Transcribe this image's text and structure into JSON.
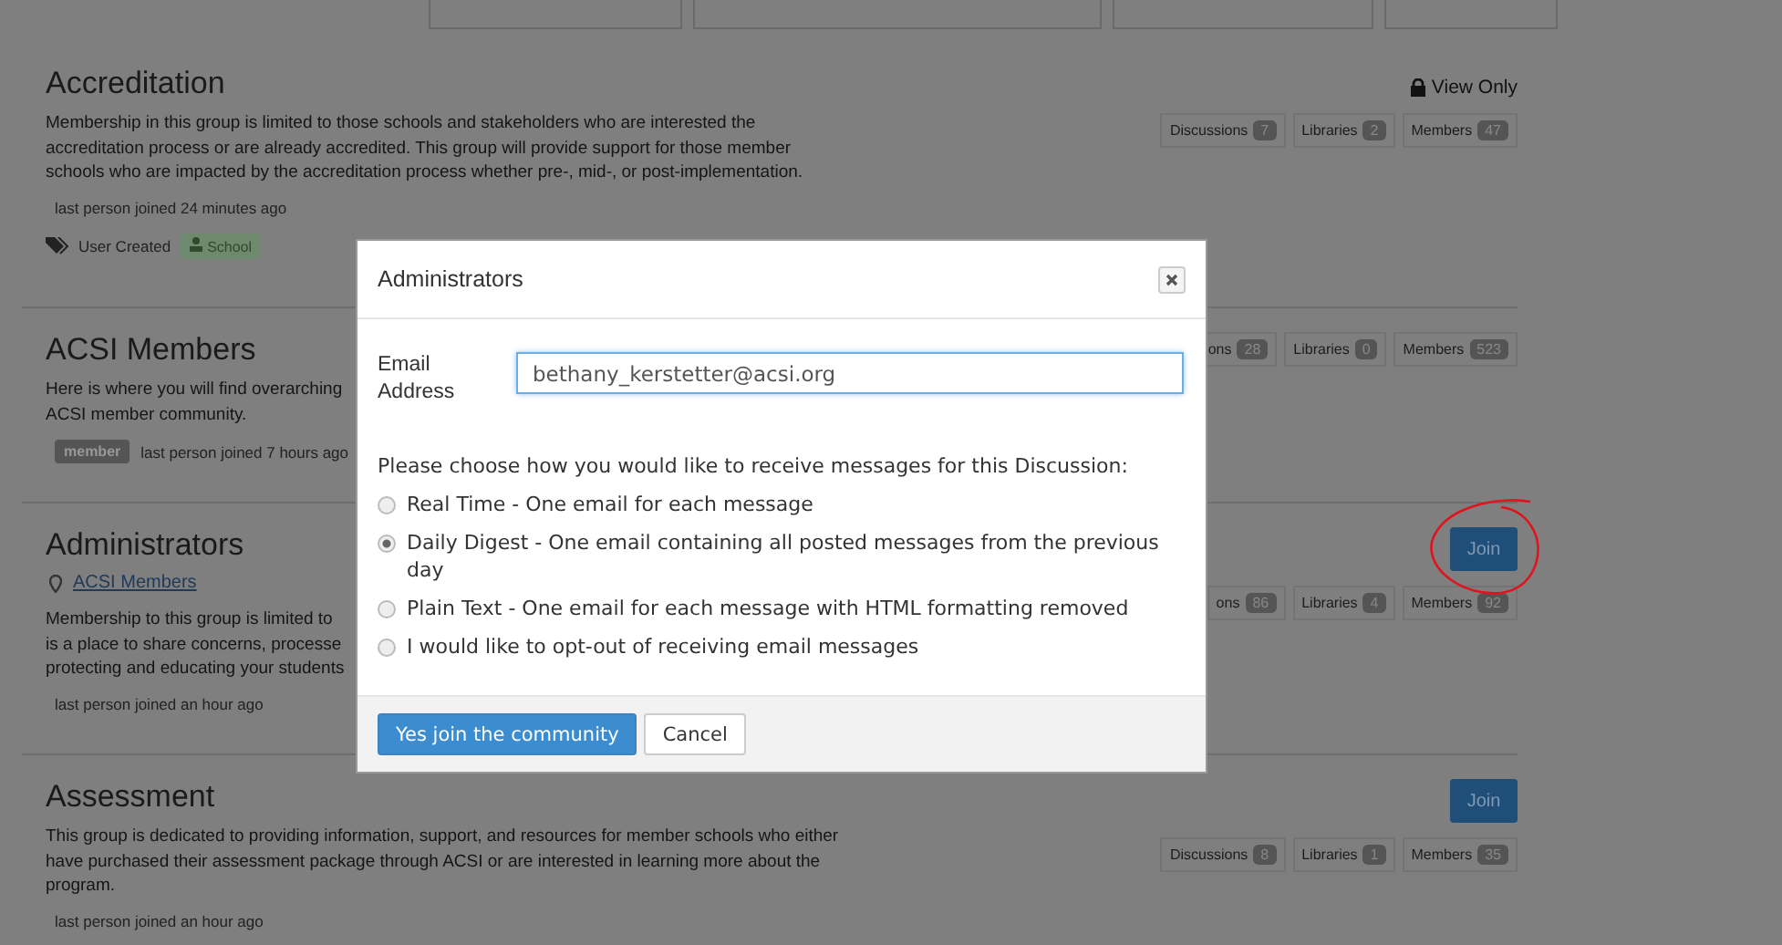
{
  "filters": [
    {
      "kind": "dropdown"
    },
    {
      "kind": "dropdown"
    },
    {
      "kind": "dropdown"
    },
    {
      "kind": "dropdown"
    }
  ],
  "groups": [
    {
      "title": "Accreditation",
      "description": [
        "Membership in this group is limited to those schools and stakeholders who are interested the",
        "accreditation process or are already accredited. This group will provide support for those member",
        "schools who are impacted by the accreditation process whether pre-, mid-, or post-implementation."
      ],
      "last_joined": "last person joined 24 minutes ago",
      "tags": {
        "label": "User Created",
        "badge": "School"
      },
      "action": {
        "kind": "view_only",
        "label": "View Only"
      },
      "stats": [
        {
          "label": "Discussions",
          "count": "7"
        },
        {
          "label": "Libraries",
          "count": "2"
        },
        {
          "label": "Members",
          "count": "47"
        }
      ]
    },
    {
      "title": "ACSI Members",
      "description": [
        "Here is where you will find overarching",
        "ACSI member community."
      ],
      "badge": "member",
      "last_joined": "last person joined 7 hours ago",
      "stats": [
        {
          "label": "ons",
          "count": "28"
        },
        {
          "label": "Libraries",
          "count": "0"
        },
        {
          "label": "Members",
          "count": "523"
        }
      ]
    },
    {
      "title": "Administrators",
      "location": "ACSI Members",
      "description": [
        "Membership to this group is limited to",
        "is a place to share concerns, processe",
        "protecting and educating your students"
      ],
      "last_joined": "last person joined an hour ago",
      "action": {
        "kind": "join",
        "label": "Join",
        "circled": true
      },
      "stats": [
        {
          "label": "ons",
          "count": "86"
        },
        {
          "label": "Libraries",
          "count": "4"
        },
        {
          "label": "Members",
          "count": "92"
        }
      ]
    },
    {
      "title": "Assessment",
      "description": [
        "This group is dedicated to providing information, support, and resources for member schools who either",
        "have purchased their assessment package through ACSI or are interested in learning more about the",
        "program."
      ],
      "last_joined": "last person joined an hour ago",
      "action": {
        "kind": "join",
        "label": "Join",
        "circled": false
      },
      "stats": [
        {
          "label": "Discussions",
          "count": "8"
        },
        {
          "label": "Libraries",
          "count": "1"
        },
        {
          "label": "Members",
          "count": "35"
        }
      ]
    }
  ],
  "modal": {
    "title": "Administrators",
    "email_label": "Email Address",
    "email_value": "bethany_kerstetter@acsi.org",
    "prompt": "Please choose how you would like to receive messages for this Discussion:",
    "options": [
      {
        "label": "Real Time - One email for each message",
        "selected": false
      },
      {
        "label": "Daily Digest - One email containing all posted messages from the previous day",
        "selected": true
      },
      {
        "label": "Plain Text - One email for each message with HTML formatting removed",
        "selected": false
      },
      {
        "label": "I would like to opt-out of receiving email messages",
        "selected": false
      }
    ],
    "buttons": [
      {
        "kind": "primary",
        "label": "Yes join the community"
      },
      {
        "kind": "default",
        "label": "Cancel"
      }
    ]
  }
}
